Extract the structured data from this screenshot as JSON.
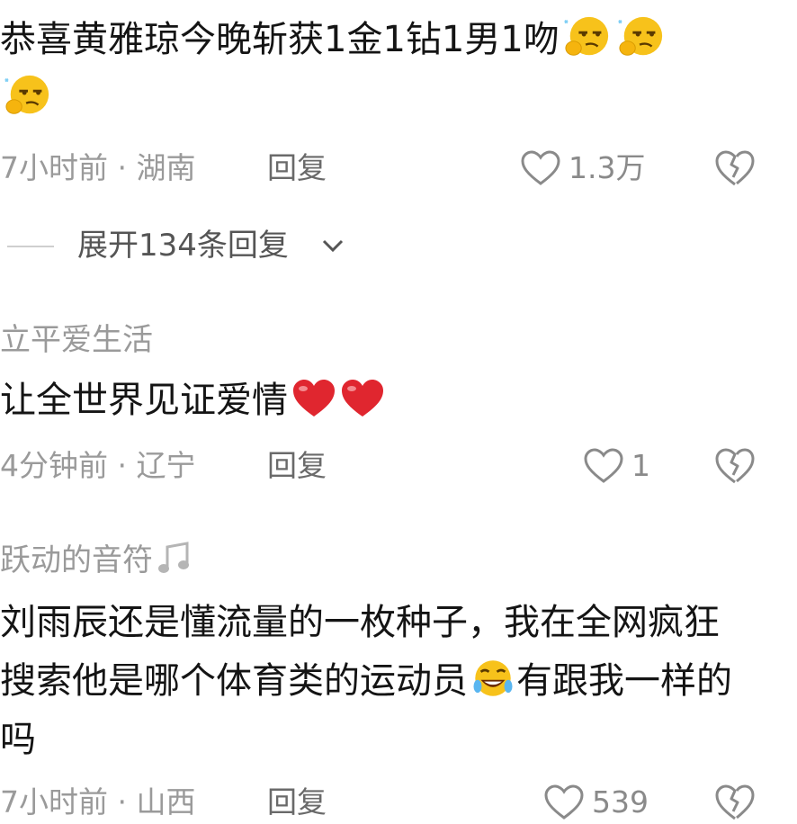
{
  "comments": [
    {
      "username": "",
      "text": "恭喜黄雅琼今晚斩获1金1钻1男1吻",
      "emojis": [
        "smirk-hand-emoji",
        "smirk-hand-emoji",
        "smirk-hand-emoji"
      ],
      "time": "7小时前 · 湖南",
      "reply_label": "回复",
      "likes": "1.3万"
    },
    {
      "username": "立平爱生活",
      "text": "让全世界见证爱情",
      "emojis": [
        "red-heart-emoji",
        "red-heart-emoji"
      ],
      "time": "4分钟前 · 辽宁",
      "reply_label": "回复",
      "likes": "1"
    },
    {
      "username": "跃动的音符",
      "username_icon": "music-note-icon",
      "text_before_emoji": "刘雨辰还是懂流量的一枚种子，我在全网疯狂搜索他是哪个体育类的运动员",
      "text_after_emoji": "有跟我一样的吗",
      "emojis": [
        "rofl-emoji"
      ],
      "time": "7小时前 · 山西",
      "reply_label": "回复",
      "likes": "539"
    }
  ],
  "expand_replies": "展开134条回复",
  "icons": {
    "like": "heart-outline-icon",
    "dislike": "broken-heart-icon",
    "expand": "chevron-down-icon"
  },
  "colors": {
    "text": "#141414",
    "muted": "#9a9a9a",
    "heart_red": "#e0262f",
    "emoji_yellow": "#f7c21b"
  }
}
